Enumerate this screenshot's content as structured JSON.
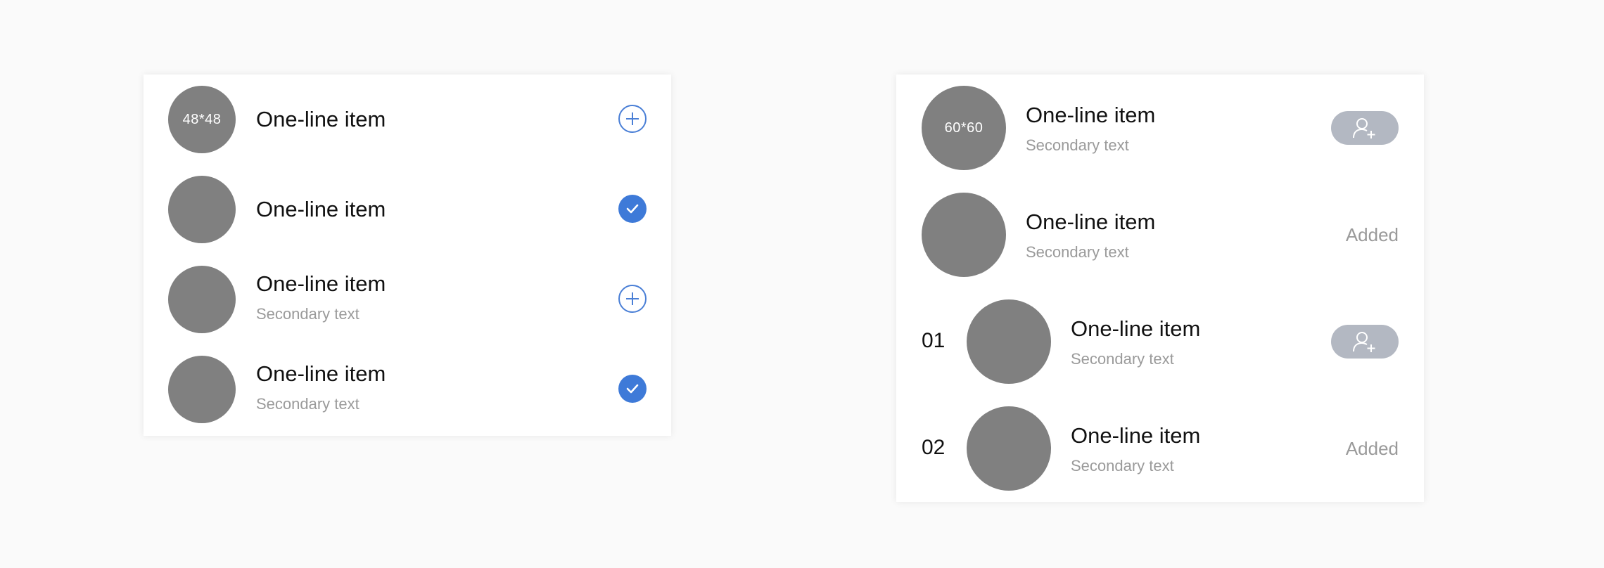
{
  "left_list": {
    "items": [
      {
        "avatar_label": "48*48",
        "title": "One-line item",
        "action": "add"
      },
      {
        "avatar_label": "",
        "title": "One-line item",
        "action": "selected"
      },
      {
        "avatar_label": "",
        "title": "One-line item",
        "subtitle": "Secondary text",
        "action": "add"
      },
      {
        "avatar_label": "",
        "title": "One-line item",
        "subtitle": "Secondary text",
        "action": "selected"
      }
    ]
  },
  "right_list": {
    "items": [
      {
        "avatar_label": "60*60",
        "title": "One-line item",
        "subtitle": "Secondary text",
        "action": "add-user"
      },
      {
        "avatar_label": "",
        "title": "One-line item",
        "subtitle": "Secondary text",
        "action": "added",
        "status": "Added"
      },
      {
        "rank": "01",
        "avatar_label": "",
        "title": "One-line item",
        "subtitle": "Secondary text",
        "action": "add-user"
      },
      {
        "rank": "02",
        "avatar_label": "",
        "title": "One-line item",
        "subtitle": "Secondary text",
        "action": "added",
        "status": "Added"
      }
    ]
  },
  "colors": {
    "accent": "#3e7ad8",
    "avatar": "#808080",
    "pill": "#b3b8c2",
    "secondary_text": "#9a9a9a"
  }
}
